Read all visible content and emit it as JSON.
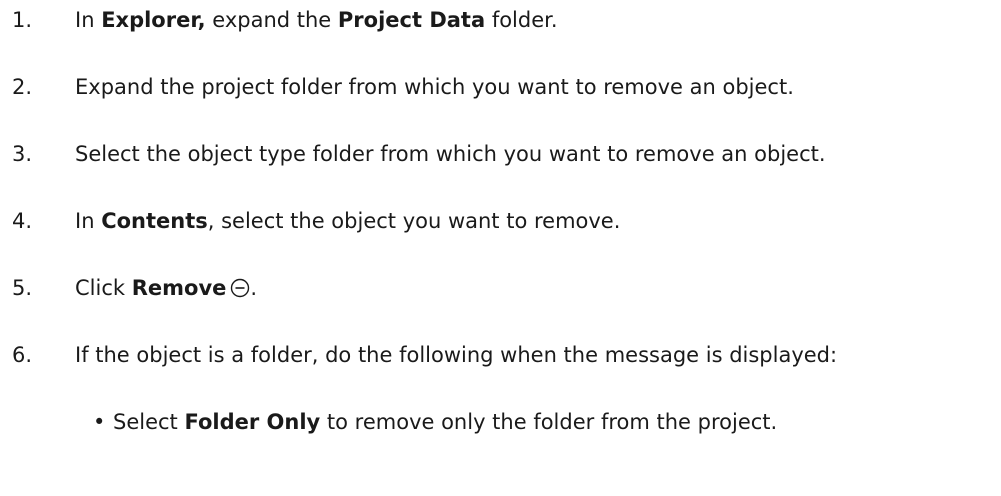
{
  "steps": [
    {
      "num": "1.",
      "parts": [
        {
          "text": "In ",
          "bold": false
        },
        {
          "text": "Explorer,",
          "bold": true
        },
        {
          "text": " expand the ",
          "bold": false
        },
        {
          "text": "Project Data",
          "bold": true
        },
        {
          "text": " folder.",
          "bold": false
        }
      ]
    },
    {
      "num": "2.",
      "parts": [
        {
          "text": "Expand the project folder from which you want to remove an object.",
          "bold": false
        }
      ]
    },
    {
      "num": "3.",
      "parts": [
        {
          "text": "Select the object type folder from which you want to remove an object.",
          "bold": false
        }
      ]
    },
    {
      "num": "4.",
      "parts": [
        {
          "text": "In ",
          "bold": false
        },
        {
          "text": "Contents",
          "bold": true
        },
        {
          "text": ", select the object you want to remove.",
          "bold": false
        }
      ]
    },
    {
      "num": "5.",
      "parts": [
        {
          "text": "Click ",
          "bold": false
        },
        {
          "text": "Remove",
          "bold": true
        },
        {
          "icon": "remove-circle-icon"
        },
        {
          "text": ".",
          "bold": false
        }
      ]
    },
    {
      "num": "6.",
      "parts": [
        {
          "text": "If the object is a folder, do the following when the message is displayed:",
          "bold": false
        }
      ]
    }
  ],
  "bullets": [
    {
      "dot": "•",
      "parts": [
        {
          "text": "Select ",
          "bold": false
        },
        {
          "text": "Folder Only",
          "bold": true
        },
        {
          "text": " to remove only the folder from the project.",
          "bold": false
        }
      ]
    }
  ]
}
